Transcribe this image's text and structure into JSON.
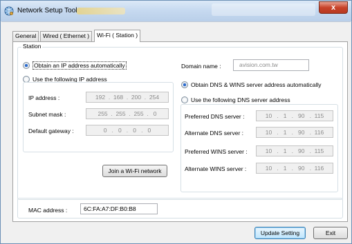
{
  "window": {
    "title": "Network Setup Tool",
    "close_symbol": "x",
    "icon": "network-globe-icon"
  },
  "tabs": [
    {
      "label": "General",
      "active": false
    },
    {
      "label": "Wired ( Ethernet )",
      "active": false
    },
    {
      "label": "Wi-Fi ( Station )",
      "active": true
    }
  ],
  "station": {
    "group_label": "Station",
    "ip_mode": {
      "auto_label": "Obtain an IP address automatically",
      "auto_checked": true,
      "manual_label": "Use the following IP address",
      "manual_checked": false
    },
    "ip_fields": [
      {
        "label": "IP address :",
        "value": "192  .  168  .  200  .  254"
      },
      {
        "label": "Subnet mask :",
        "value": "255  .  255  .  255  .   0"
      },
      {
        "label": "Default gateway :",
        "value": "0   .   0   .   0   .   0"
      }
    ],
    "join_button": "Join a Wi-Fi network",
    "domain_label": "Domain name :",
    "domain_value": "avision.com.tw",
    "dns_mode": {
      "auto_label": "Obtain DNS & WINS server address automatically",
      "auto_checked": true,
      "manual_label": "Use the following DNS server address",
      "manual_checked": false
    },
    "dns_fields": [
      {
        "label": "Preferred DNS server :",
        "value": "10   .   1   .   90   .  115"
      },
      {
        "label": "Alternate DNS server :",
        "value": "10   .   1   .   90   .  116"
      },
      {
        "label": "Preferred WINS server :",
        "value": "10   .   1   .   90   .  115"
      },
      {
        "label": "Alternate WINS server :",
        "value": "10   .   1   .   90   .  116"
      }
    ],
    "mac_label": "MAC address :",
    "mac_value": "6C:FA:A7:DF:B0:B8"
  },
  "footer": {
    "update_button": "Update Setting",
    "exit_button": "Exit"
  },
  "colors": {
    "titlebar": "#c7daf0",
    "close_button": "#c8432a",
    "radio_dot": "#2b6ccf",
    "default_button_border": "#3c7fb1"
  }
}
